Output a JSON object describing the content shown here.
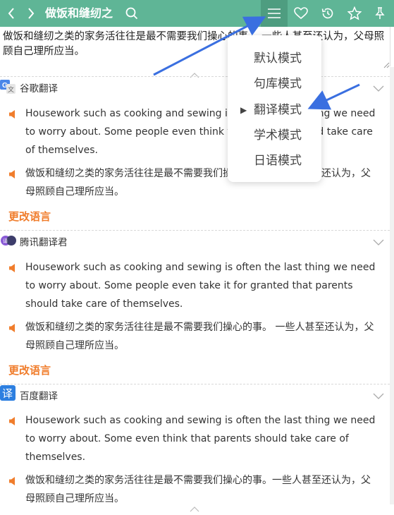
{
  "toolbar": {
    "title": "做饭和缝纫之",
    "icons": [
      "chevron-left-icon",
      "chevron-right-icon",
      "search-icon",
      "menu-icon",
      "heart-icon",
      "history-icon",
      "star-icon",
      "pin-icon"
    ],
    "accent_color": "#5fb596"
  },
  "input": {
    "text": "做饭和缝纫之类的家务活往往是最不需要我们操心的事。 一些人甚至还认为，父母照顾自己理所应当。"
  },
  "engines": [
    {
      "name": "谷歌翻译",
      "icon": "google-translate-icon",
      "english": "Housework such as cooking and sewing is often the last thing we need to worry about. Some people even think that parents should take care of themselves.",
      "chinese": "做饭和缝纫之类的家务活往往是最不需要我们操心的事。一些人甚至还认为，父母照顾自己理所应当。",
      "change_language": "更改语言"
    },
    {
      "name": "腾讯翻译君",
      "icon": "tencent-translate-icon",
      "english": "Housework such as cooking and sewing is often the last thing we need to worry about. Some people even take it for granted that parents should take care of themselves.",
      "chinese": "做饭和缝纫之类的家务活往往是最不需要我们操心的事。 一些人甚至还认为，父母照顾自己理所应当。",
      "change_language": "更改语言"
    },
    {
      "name": "百度翻译",
      "icon": "baidu-translate-icon",
      "english": "Housework such as cooking and sewing is often the last thing we need to worry about. Some even think that parents should take care of themselves.",
      "chinese": "做饭和缝纫之类的家务活往往是最不需要我们操心的事。一些人甚至还认为，父母照顾自己理所应当。"
    }
  ],
  "mode_menu": {
    "items": [
      "默认模式",
      "句库模式",
      "翻译模式",
      "学术模式",
      "日语模式"
    ],
    "selected": "翻译模式",
    "selected_marker": "▶"
  },
  "colors": {
    "speaker": "#f07d2c",
    "change_language": "#f07d2c",
    "annotation_arrow": "#3a6fe0"
  }
}
